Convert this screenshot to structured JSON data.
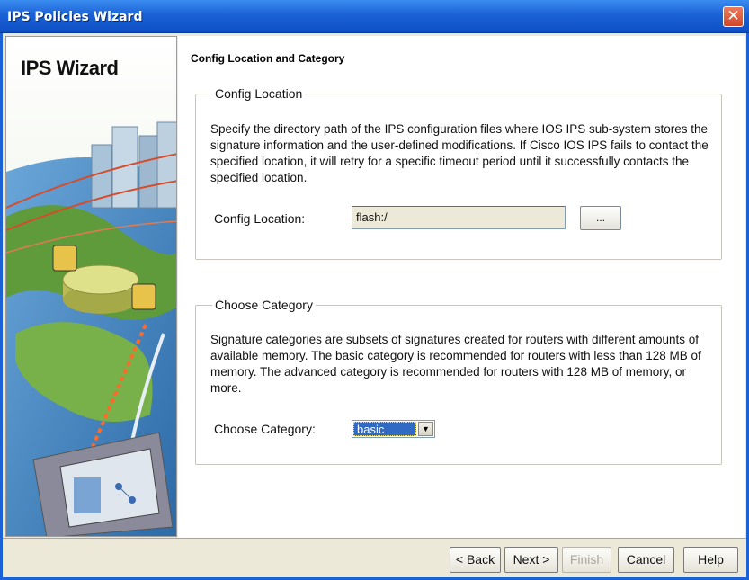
{
  "window": {
    "title": "IPS Policies Wizard",
    "close_glyph": "✕"
  },
  "sidebar": {
    "title": "IPS Wizard"
  },
  "page": {
    "heading": "Config Location and Category"
  },
  "config_location": {
    "legend": "Config Location",
    "description": "Specify the directory path of the IPS configuration files where IOS IPS sub-system stores the signature information and the user-defined modifications. If Cisco IOS IPS fails to contact the specified location, it will retry for a specific timeout period until it successfully contacts the specified location.",
    "field_label": "Config Location:",
    "field_value": "flash:/",
    "browse_label": "..."
  },
  "category": {
    "legend": "Choose Category",
    "description": "Signature categories are subsets of signatures created for routers with different amounts of available memory. The basic category is recommended for routers with less than 128 MB of memory. The advanced category is recommended for routers with 128 MB of memory, or more.",
    "field_label": "Choose Category:",
    "selected": "basic",
    "arrow_glyph": "▼"
  },
  "buttons": {
    "back": "< Back",
    "next": "Next >",
    "finish": "Finish",
    "cancel": "Cancel",
    "help": "Help"
  },
  "colors": {
    "titlebar": "#1b62d6",
    "dialog_bg": "#ece9d8",
    "selection": "#316ac5"
  }
}
